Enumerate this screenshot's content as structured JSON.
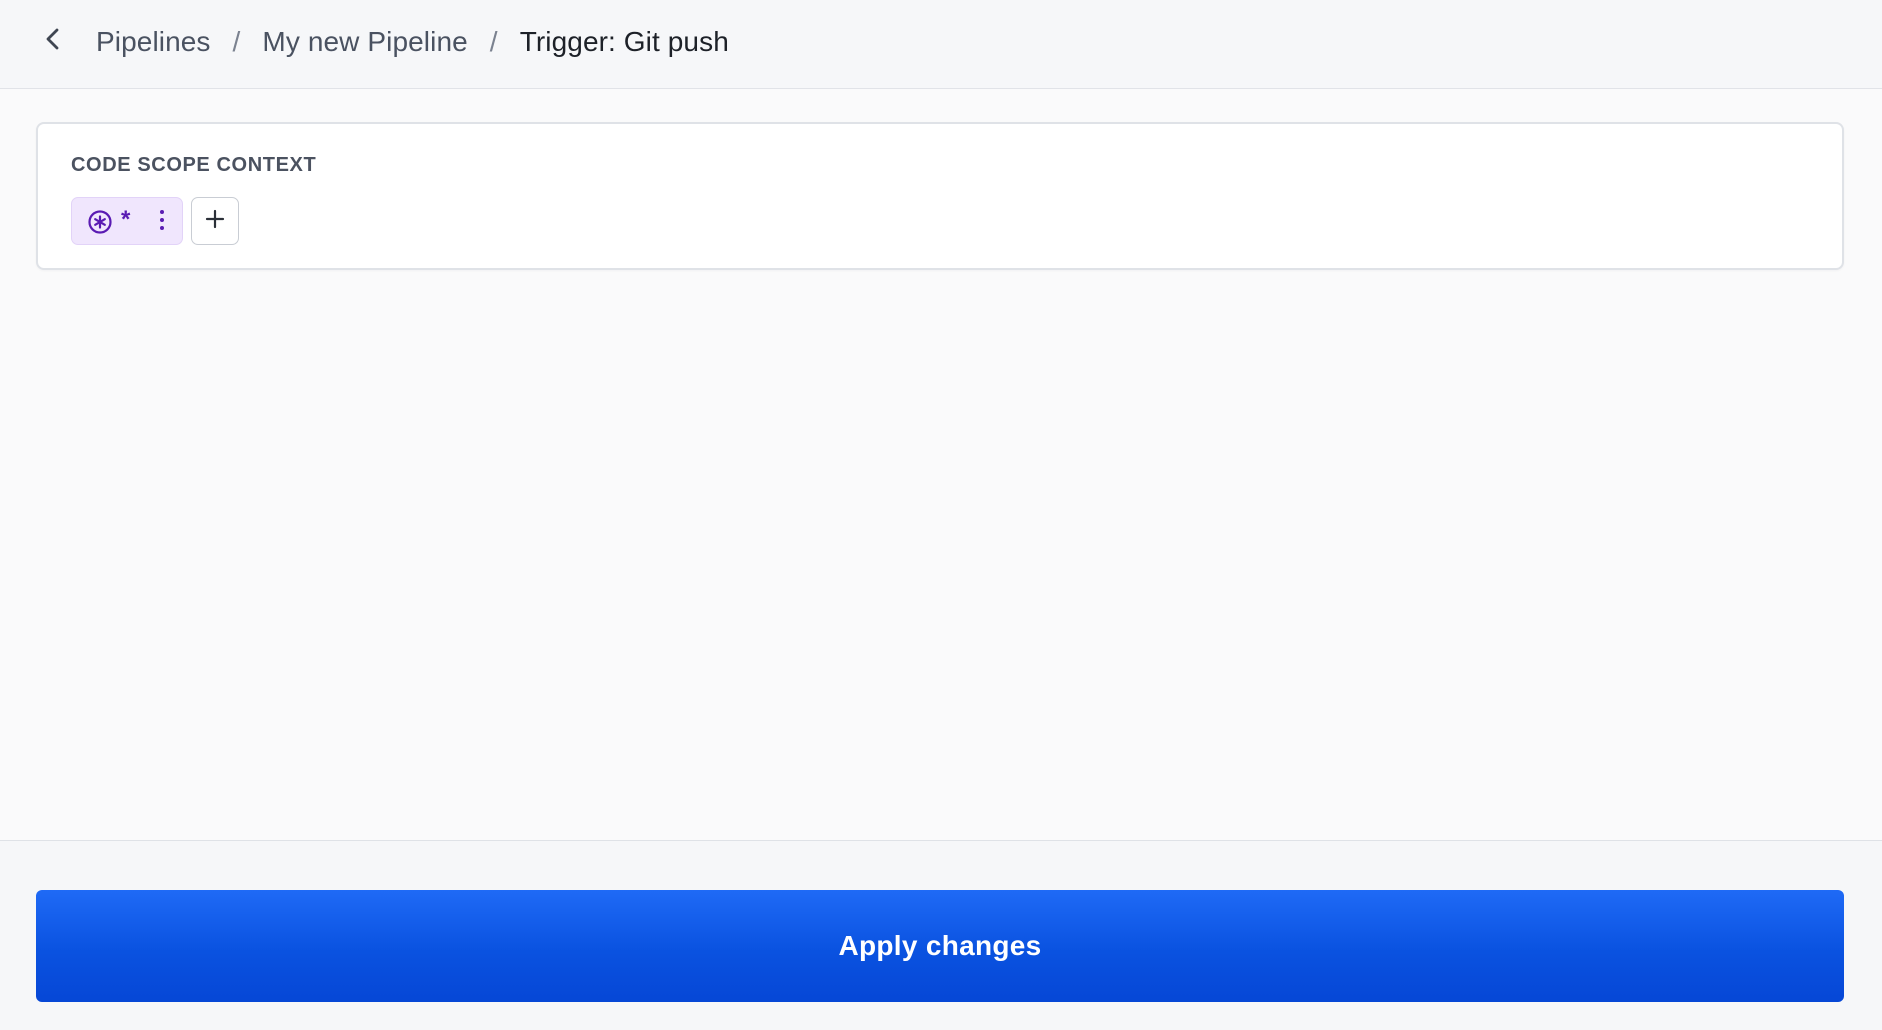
{
  "breadcrumb": {
    "items": [
      "Pipelines",
      "My new Pipeline"
    ],
    "separator": "/",
    "current": "Trigger: Git push"
  },
  "icons": {
    "back": "chevron-left-icon",
    "scope": "asterisk-circle-icon",
    "menu": "vertical-dots-icon",
    "add": "plus-icon"
  },
  "card": {
    "title": "CODE SCOPE CONTEXT",
    "chip": {
      "label": "*"
    }
  },
  "footer": {
    "apply_label": "Apply changes"
  },
  "colors": {
    "accent": "#1f6af6",
    "chip_bg": "#f0e6fd",
    "chip_fg": "#5a1bb3"
  }
}
